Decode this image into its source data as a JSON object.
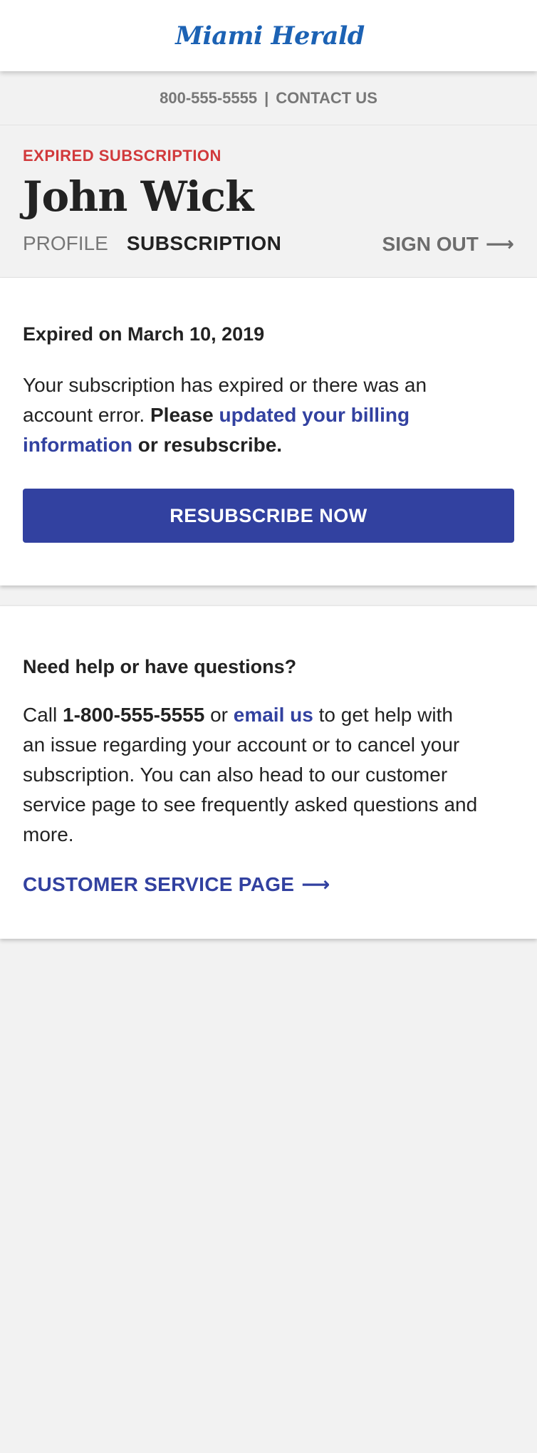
{
  "header": {
    "logo_text": "Miami Herald"
  },
  "contact_bar": {
    "phone": "800-555-5555",
    "separator": "|",
    "contact_link": "CONTACT US"
  },
  "profile": {
    "status": "EXPIRED SUBSCRIPTION",
    "name": "John Wick",
    "tabs": [
      {
        "label": "PROFILE",
        "active": false
      },
      {
        "label": "SUBSCRIPTION",
        "active": true
      }
    ],
    "sign_out": "SIGN OUT",
    "sign_out_icon": "arrow-right-icon"
  },
  "subscription": {
    "expired_on": "Expired on March 10, 2019",
    "message_prefix": "Your subscription has expired or there was an account error. ",
    "message_please": "Please",
    "message_link": "updated your billing information",
    "message_suffix": "or resubscribe.",
    "button": "RESUBSCRIBE NOW"
  },
  "help": {
    "heading": "Need help or have questions?",
    "body_call": "Call",
    "phone": "1-800-555-5555",
    "body_or": "or",
    "email_link": "email us",
    "body_rest": "to get help with an issue regarding your account or to cancel your subscription. You can also head to our customer service page to see frequently asked questions and more.",
    "cs_link": "CUSTOMER SERVICE PAGE",
    "cs_icon": "arrow-right-icon"
  },
  "colors": {
    "brand_blue": "#1c62b4",
    "accent": "#3241a0",
    "status_red": "#d1393b",
    "background": "#f2f2f2"
  }
}
